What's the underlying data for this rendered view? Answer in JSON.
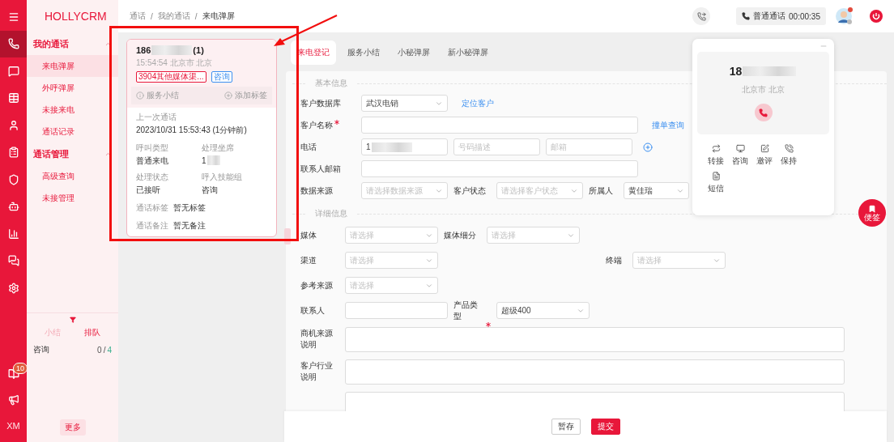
{
  "rail": {
    "items": [
      {
        "selected": false
      },
      {
        "selected": true
      },
      {
        "selected": false
      },
      {
        "selected": false
      },
      {
        "selected": false
      },
      {
        "selected": false
      },
      {
        "selected": false
      },
      {
        "selected": false
      },
      {
        "selected": false
      },
      {
        "selected": false
      },
      {
        "selected": false
      }
    ],
    "book_badge": "10",
    "user_initials": "XM"
  },
  "sidebar": {
    "logo": "HOLLYCRM",
    "groups": [
      {
        "title": "我的通话",
        "expanded": true,
        "items": [
          {
            "label": "来电弹屏",
            "selected": true
          },
          {
            "label": "外呼弹屏",
            "selected": false
          },
          {
            "label": "未接来电",
            "selected": false
          },
          {
            "label": "通话记录",
            "selected": false
          }
        ]
      },
      {
        "title": "通话管理",
        "expanded": true,
        "items": [
          {
            "label": "高级查询",
            "selected": false
          },
          {
            "label": "未接管理",
            "selected": false
          }
        ]
      }
    ],
    "queue": {
      "tabs": [
        {
          "label": "小结",
          "selected": false
        },
        {
          "label": "排队",
          "selected": true
        }
      ],
      "rows": [
        {
          "name": "咨询",
          "count": "0",
          "separator": "/",
          "total": "4"
        }
      ]
    },
    "more_button": "更多"
  },
  "header": {
    "breadcrumb": {
      "separator": "/",
      "items": [
        "通话",
        "我的通话",
        "来电弹屏"
      ]
    },
    "call_status": {
      "label": "普通通话",
      "timer": "00:00:35"
    }
  },
  "call_card": {
    "number_prefix": "186",
    "number_suffix": "(1)",
    "time_place": "15:54:54 北京市 北京",
    "tags": [
      {
        "text": "3904其他媒体渠...",
        "color": "#e8173a"
      },
      {
        "text": "咨询",
        "color": "#3b8ff0"
      }
    ],
    "actions": [
      "服务小结",
      "添加标签"
    ],
    "last_call_label": "上一次通话",
    "last_call": "2023/10/31 15:53:43  (1分钟前)",
    "fields": [
      {
        "label": "呼叫类型",
        "value": "普通来电",
        "redacted": false
      },
      {
        "label": "处理坐席",
        "value": "1",
        "redacted": true
      },
      {
        "label": "处理状态",
        "value": "已接听",
        "redacted": false
      },
      {
        "label": "呼入技能组",
        "value": "咨询",
        "redacted": false
      }
    ],
    "notes": [
      {
        "label": "通话标签",
        "value": "暂无标签"
      },
      {
        "label": "通话备注",
        "value": "暂无备注"
      }
    ]
  },
  "tabs": [
    {
      "label": "来电登记",
      "selected": true
    },
    {
      "label": "服务小结",
      "selected": false
    },
    {
      "label": "小秘弹屏",
      "selected": false
    },
    {
      "label": "新小秘弹屏",
      "selected": false
    }
  ],
  "basic_info": {
    "title": "基本信息",
    "rows": [
      {
        "label": "客户数据库",
        "required": false,
        "controls": [
          {
            "kind": "select",
            "value": "武汉电销"
          },
          {
            "kind": "link",
            "text": "定位客户"
          }
        ]
      },
      {
        "label": "客户名称",
        "required": true,
        "controls": [
          {
            "kind": "input",
            "wide": true
          },
          {
            "kind": "link",
            "text": "撞单查询"
          }
        ]
      },
      {
        "label": "电话",
        "required": false,
        "controls": [
          {
            "kind": "input",
            "wide": false,
            "value": "1",
            "redacted": true
          },
          {
            "kind": "input",
            "wide": false,
            "placeholder": "号码描述"
          },
          {
            "kind": "input",
            "wide": false,
            "placeholder": "邮箱"
          },
          {
            "kind": "add"
          }
        ]
      },
      {
        "label": "联系人邮箱",
        "required": false,
        "controls": [
          {
            "kind": "input",
            "wide": true
          }
        ]
      },
      {
        "label": "数据来源",
        "required": false,
        "controls": [
          {
            "kind": "select",
            "placeholder": "请选择数据来源"
          },
          {
            "kind": "label",
            "text": "客户状态"
          },
          {
            "kind": "select",
            "placeholder": "请选择客户状态"
          },
          {
            "kind": "label",
            "text": "所属人"
          },
          {
            "kind": "select",
            "value": "黄佳瑞"
          }
        ]
      }
    ]
  },
  "detail_info": {
    "title": "详细信息",
    "rows": [
      {
        "label": "媒体",
        "controls": [
          {
            "kind": "select",
            "placeholder": "请选择"
          },
          {
            "kind": "label",
            "text": "媒体细分"
          },
          {
            "kind": "select",
            "placeholder": "请选择"
          }
        ]
      },
      {
        "label": "渠道",
        "controls": [
          {
            "kind": "select",
            "placeholder": "请选择"
          }
        ],
        "right_controls": [
          {
            "kind": "label",
            "text": "终端"
          },
          {
            "kind": "select",
            "placeholder": "请选择"
          }
        ]
      },
      {
        "label": "参考来源",
        "controls": [
          {
            "kind": "select",
            "placeholder": "请选择"
          }
        ]
      },
      {
        "label": "联系人",
        "controls": [
          {
            "kind": "input",
            "wide": false
          },
          {
            "kind": "label",
            "text": "产品类型",
            "required": true
          },
          {
            "kind": "select",
            "value": "超级400"
          }
        ]
      },
      {
        "label": "商机来源说明",
        "controls": [
          {
            "kind": "textarea"
          }
        ]
      },
      {
        "label": "客户行业说明",
        "controls": [
          {
            "kind": "textarea"
          }
        ]
      },
      {
        "controls": [
          {
            "kind": "textarea"
          }
        ]
      }
    ]
  },
  "footer_buttons": [
    {
      "label": "暂存",
      "kind": "default"
    },
    {
      "label": "提交",
      "kind": "primary"
    }
  ],
  "call_panel": {
    "number_prefix": "18",
    "location": "北京市 北京",
    "actions": [
      "转接",
      "咨询",
      "邀评",
      "保持",
      "短信"
    ]
  },
  "float_button": {
    "label": "便签"
  }
}
